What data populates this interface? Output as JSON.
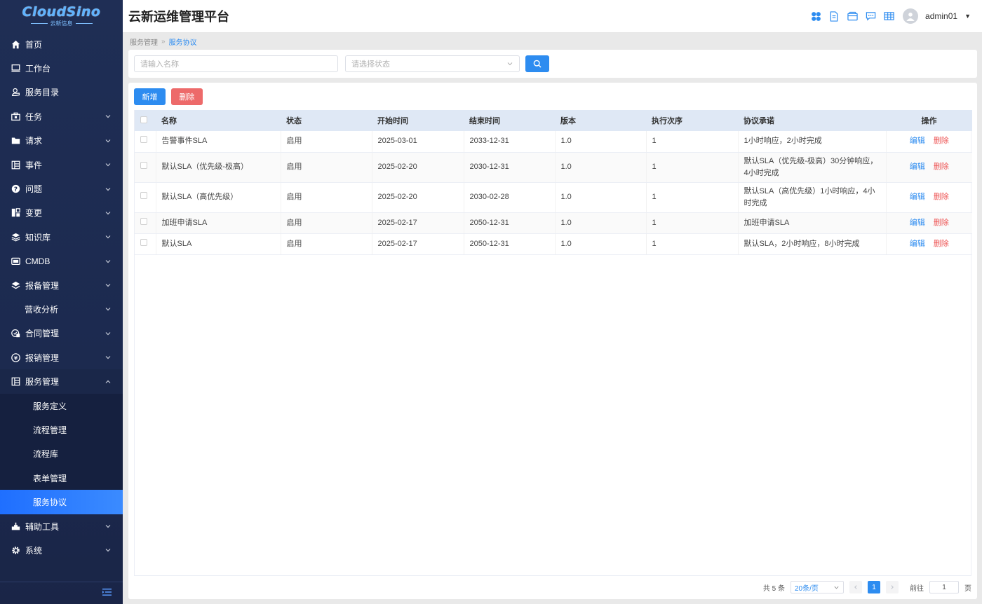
{
  "logo": {
    "main": "CloudSino",
    "sub": "云新信息"
  },
  "header": {
    "title": "云新运维管理平台",
    "username": "admin01"
  },
  "sidebar": {
    "items": [
      {
        "label": "首页",
        "icon": "home-icon",
        "chevron": false
      },
      {
        "label": "工作台",
        "icon": "monitor-icon",
        "chevron": false
      },
      {
        "label": "服务目录",
        "icon": "service-directory-icon",
        "chevron": false
      },
      {
        "label": "任务",
        "icon": "task-icon",
        "chevron": true
      },
      {
        "label": "请求",
        "icon": "folder-icon",
        "chevron": true
      },
      {
        "label": "事件",
        "icon": "event-grid-icon",
        "chevron": true
      },
      {
        "label": "问题",
        "icon": "question-icon",
        "chevron": true
      },
      {
        "label": "变更",
        "icon": "change-icon",
        "chevron": true
      },
      {
        "label": "知识库",
        "icon": "layers-icon",
        "chevron": true
      },
      {
        "label": "CMDB",
        "icon": "cmdb-icon",
        "chevron": true
      },
      {
        "label": "报备管理",
        "icon": "stack-icon",
        "chevron": true
      },
      {
        "label": "营收分析",
        "icon": "",
        "chevron": true
      },
      {
        "label": "合同管理",
        "icon": "contract-icon",
        "chevron": true
      },
      {
        "label": "报销管理",
        "icon": "yen-icon",
        "chevron": true
      },
      {
        "label": "服务管理",
        "icon": "service-grid-icon",
        "chevron": true,
        "expanded": true
      }
    ],
    "submenu": [
      {
        "label": "服务定义"
      },
      {
        "label": "流程管理"
      },
      {
        "label": "流程库"
      },
      {
        "label": "表单管理"
      },
      {
        "label": "服务协议",
        "active": true
      }
    ],
    "bottom_items": [
      {
        "label": "辅助工具",
        "icon": "tools-icon",
        "chevron": true
      },
      {
        "label": "系统",
        "icon": "gear-icon",
        "chevron": true
      }
    ]
  },
  "breadcrumb": {
    "parent": "服务管理",
    "separator": "»",
    "current": "服务协议"
  },
  "search": {
    "name_placeholder": "请输入名称",
    "status_placeholder": "请选择状态"
  },
  "toolbar": {
    "add_label": "新增",
    "delete_label": "删除"
  },
  "table": {
    "columns": [
      "名称",
      "状态",
      "开始时间",
      "结束时间",
      "版本",
      "执行次序",
      "协议承诺",
      "操作"
    ],
    "rows": [
      {
        "name": "告警事件SLA",
        "status": "启用",
        "start": "2025-03-01",
        "end": "2033-12-31",
        "version": "1.0",
        "order": "1",
        "promise": "1小时响应，2小时完成",
        "edit": "编辑",
        "delete": "删除"
      },
      {
        "name": "默认SLA（优先级-极高）",
        "status": "启用",
        "start": "2025-02-20",
        "end": "2030-12-31",
        "version": "1.0",
        "order": "1",
        "promise": "默认SLA（优先级-极高）30分钟响应，4小时完成",
        "edit": "编辑",
        "delete": "删除"
      },
      {
        "name": "默认SLA（高优先级）",
        "status": "启用",
        "start": "2025-02-20",
        "end": "2030-02-28",
        "version": "1.0",
        "order": "1",
        "promise": "默认SLA（高优先级）1小时响应，4小时完成",
        "edit": "编辑",
        "delete": "删除"
      },
      {
        "name": "加班申请SLA",
        "status": "启用",
        "start": "2025-02-17",
        "end": "2050-12-31",
        "version": "1.0",
        "order": "1",
        "promise": "加班申请SLA",
        "edit": "编辑",
        "delete": "删除"
      },
      {
        "name": "默认SLA",
        "status": "启用",
        "start": "2025-02-17",
        "end": "2050-12-31",
        "version": "1.0",
        "order": "1",
        "promise": "默认SLA，2小时响应，8小时完成",
        "edit": "编辑",
        "delete": "删除"
      }
    ]
  },
  "pagination": {
    "total": "共 5 条",
    "page_size": "20条/页",
    "current": "1",
    "goto_label": "前往",
    "goto_value": "1",
    "page_suffix": "页"
  },
  "colors": {
    "accent": "#2d8cf0",
    "danger": "#ed6a6a",
    "sidebar_bg": "#1f2e55",
    "active_item": "#2f7dff"
  }
}
